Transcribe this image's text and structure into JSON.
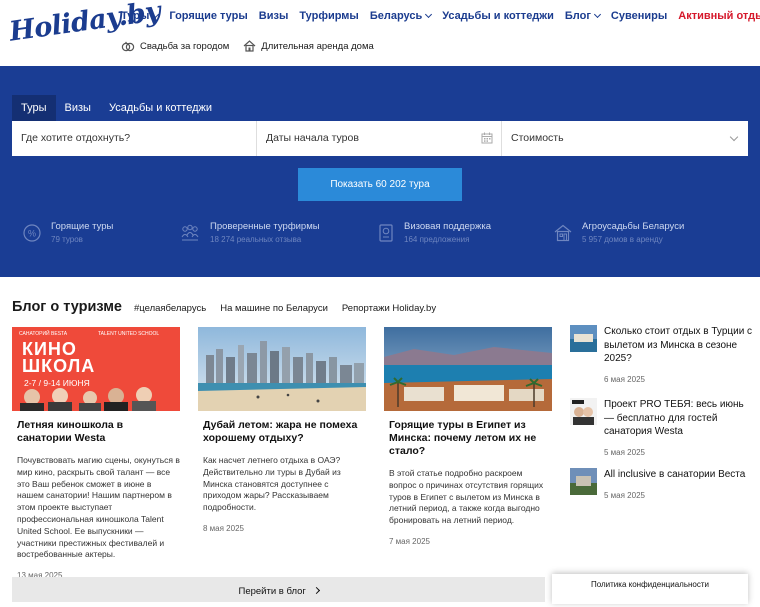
{
  "logo": {
    "line1": "Holiday",
    "line2": ".by"
  },
  "nav": [
    {
      "label": "Туры",
      "dropdown": true
    },
    {
      "label": "Горящие туры",
      "dropdown": false
    },
    {
      "label": "Визы",
      "dropdown": false
    },
    {
      "label": "Турфирмы",
      "dropdown": false
    },
    {
      "label": "Беларусь",
      "dropdown": true
    },
    {
      "label": "Усадьбы и коттеджи",
      "dropdown": false
    },
    {
      "label": "Блог",
      "dropdown": true
    },
    {
      "label": "Сувениры",
      "dropdown": false
    },
    {
      "label": "Активный отдых",
      "dropdown": false,
      "accent": "#d5182b"
    }
  ],
  "subnav": {
    "wedding": "Свадьба за городом",
    "rent": "Длительная аренда дома"
  },
  "search": {
    "tabs": [
      "Туры",
      "Визы",
      "Усадьбы и коттеджи"
    ],
    "destination_placeholder": "Где хотите отдохнуть?",
    "dates_placeholder": "Даты начала туров",
    "price_placeholder": "Стоимость",
    "submit_label": "Показать 60 202 тура"
  },
  "features": [
    {
      "title": "Горящие туры",
      "sub": "79 туров",
      "icon": "percent-icon"
    },
    {
      "title": "Проверенные турфирмы",
      "sub": "18 274 реальных отзыва",
      "icon": "people-icon"
    },
    {
      "title": "Визовая поддержка",
      "sub": "164 предложения",
      "icon": "passport-icon"
    },
    {
      "title": "Агроусадьбы Беларуси",
      "sub": "5 957 домов в аренду",
      "icon": "house-icon"
    }
  ],
  "blog": {
    "title": "Блог о туризме",
    "tags": [
      "#целаябеларусь",
      "На машине по Беларуси",
      "Репортажи Holiday.by"
    ],
    "cards": [
      {
        "img_top_left": "САНАТОРИЙ ВЕSTA",
        "img_top_right": "TALENT UNITED SCHOOL",
        "img_big1": "КИНО",
        "img_big2": "ШКОЛА",
        "img_dates": "2-7 / 9-14 ИЮНЯ",
        "title": "Летняя киношкола в санатории Westa",
        "text": "Почувствовать магию сцены, окунуться в мир кино, раскрыть свой талант — все это Ваш ребенок сможет в июне в нашем санатории! Нашим партнером в этом проекте выступает профессиональная киношкола Talent United School. Ее выпускники — участники престижных фестивалей и востребованные актеры.",
        "date": "13 мая 2025"
      },
      {
        "title": "Дубай летом: жара не помеха хорошему отдыху?",
        "text": "Как насчет летнего отдыха в ОАЭ? Действительно ли туры в Дубай из Минска становятся доступнее с приходом жары? Рассказываем подробности.",
        "date": "8 мая 2025"
      },
      {
        "title": "Горящие туры в Египет из Минска: почему летом их не стало?",
        "text": "В этой статье подробно раскроем вопрос о причинах отсутствия горящих туров в Египет с вылетом из Минска в летний период, а также когда выгодно бронировать на летний период.",
        "date": "7 мая 2025"
      }
    ],
    "side": [
      {
        "title": "Сколько стоит отдых в Турции с вылетом из Минска в сезоне 2025?",
        "date": "6 мая 2025"
      },
      {
        "title": "Проект PRO ТЕБЯ: весь июнь — бесплатно для гостей санатория Westa",
        "date": "5 мая 2025"
      },
      {
        "title": "All inclusive в санатории Веста",
        "date": "5 мая 2025"
      }
    ],
    "more_label": "Перейти в блог"
  },
  "cookie": {
    "label": "Политика конфиденциальности"
  },
  "colors": {
    "brand": "#1b3c8f",
    "hero": "#1a3d94",
    "button": "#2b8ad9",
    "accent": "#d5182b"
  }
}
